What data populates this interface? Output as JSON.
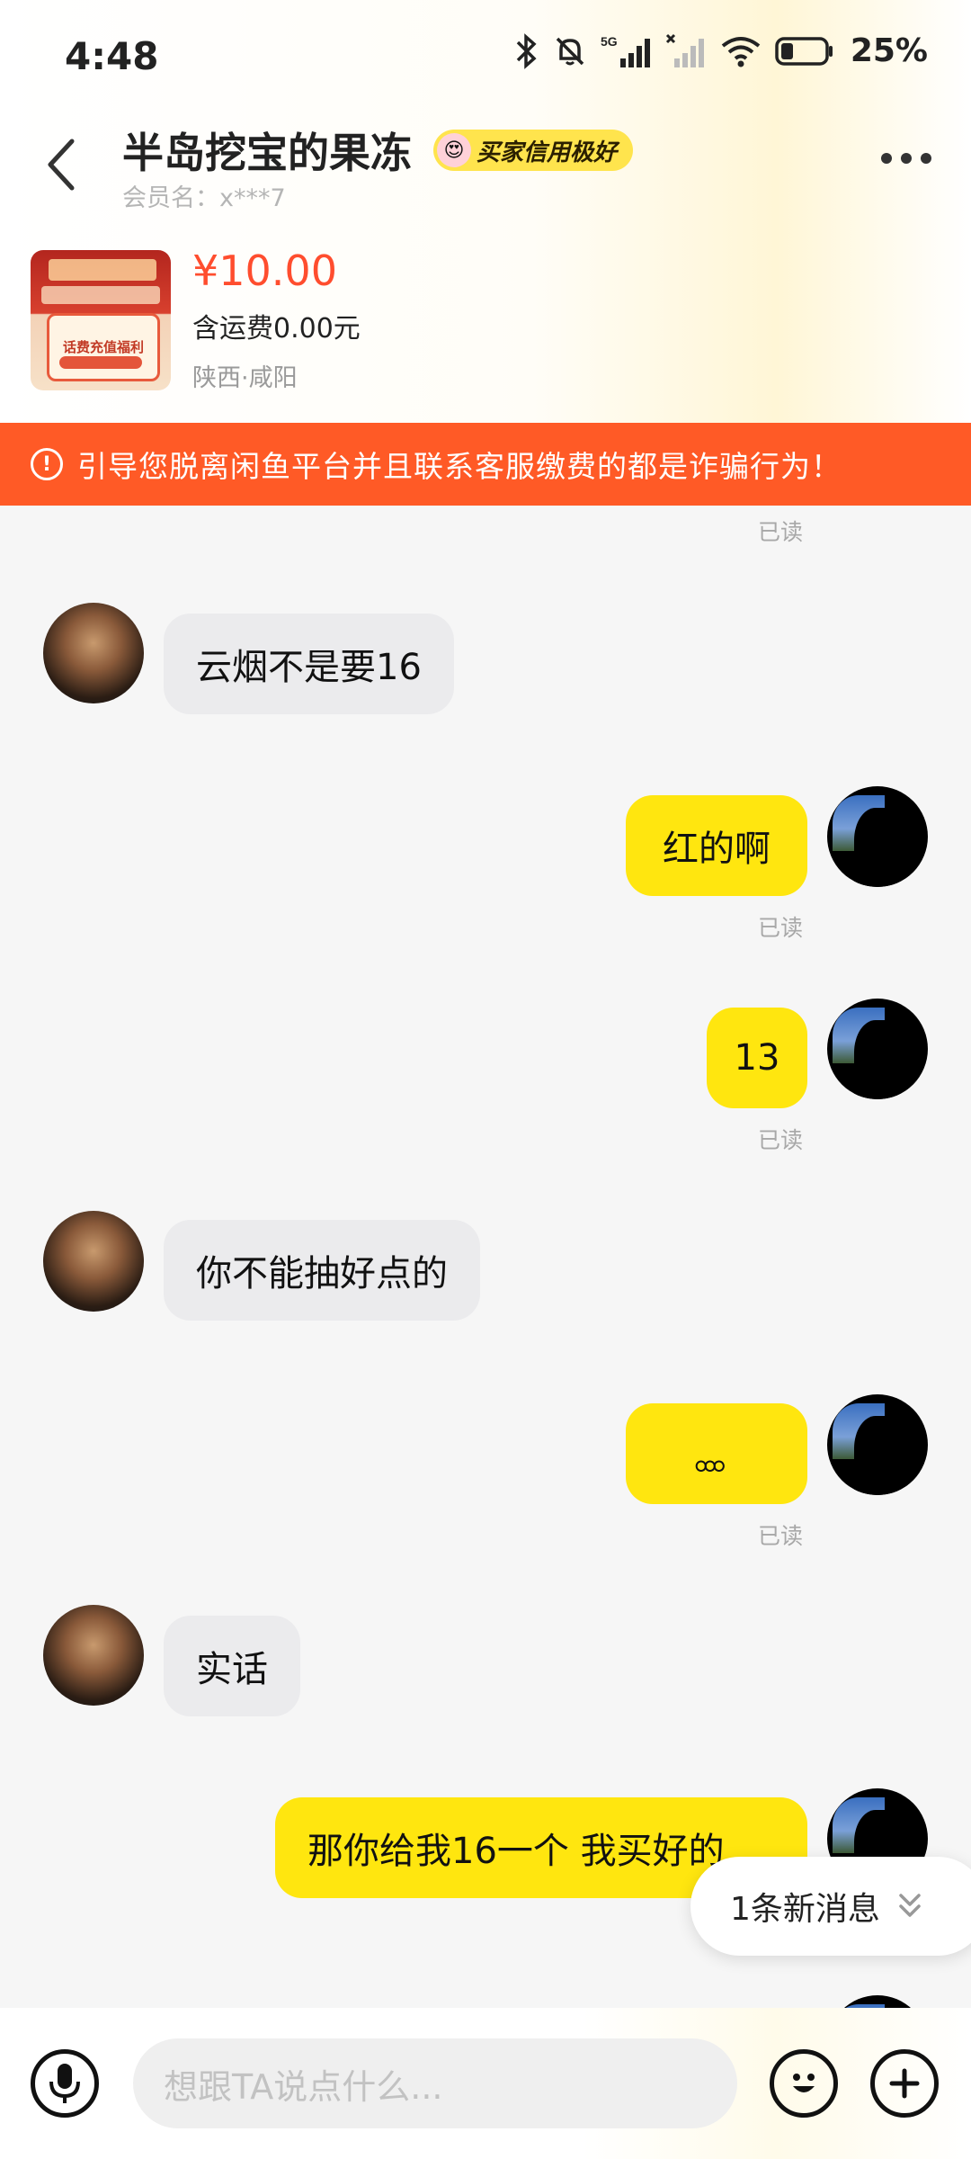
{
  "status_bar": {
    "time": "4:48",
    "battery": "25%",
    "network": "5G"
  },
  "header": {
    "title": "半岛挖宝的果冻",
    "badge": "买家信用极好",
    "member": "会员名：x***7"
  },
  "product": {
    "price": "¥10.00",
    "shipping": "含运费0.00元",
    "location": "陕西·咸阳",
    "thumbnail_text": "话费充值福利"
  },
  "warning": {
    "text": "引导您脱离闲鱼平台并且联系客服缴费的都是诈骗行为！"
  },
  "chat": {
    "read_label": "已读",
    "messages": [
      {
        "from": "other",
        "text": "云烟不是要16"
      },
      {
        "from": "self",
        "text": "红的啊"
      },
      {
        "from": "self",
        "text": "13"
      },
      {
        "from": "other",
        "text": "你不能抽好点的"
      },
      {
        "from": "self",
        "text": "。。。"
      },
      {
        "from": "other",
        "text": "实话"
      },
      {
        "from": "self",
        "text": "那你给我16一个  我买好的"
      }
    ],
    "new_message_notice": "1条新消息"
  },
  "input": {
    "placeholder": "想跟TA说点什么..."
  },
  "icons": [
    "bluetooth-icon",
    "mute-icon",
    "signal-icon",
    "wifi-icon",
    "battery-icon",
    "back-icon",
    "more-icon",
    "voice-icon",
    "emoji-icon",
    "plus-icon",
    "double-chevron-down-icon"
  ],
  "colors": {
    "accent_yellow": "#ffe60f",
    "warning_orange": "#ff5a26",
    "price_red": "#ff4d2e"
  }
}
